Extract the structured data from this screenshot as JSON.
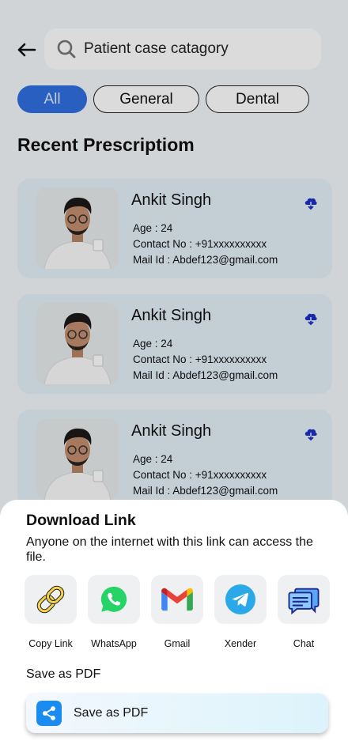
{
  "search": {
    "placeholder": "Patient case catagory"
  },
  "filters": [
    {
      "label": "All",
      "active": true
    },
    {
      "label": "General",
      "active": false
    },
    {
      "label": "Dental",
      "active": false
    }
  ],
  "section_title": "Recent Prescriptiom",
  "patients": [
    {
      "name": "Ankit Singh",
      "age": "Age : 24",
      "contact": "Contact No : +91xxxxxxxxxx",
      "mail": "Mail Id : Abdef123@gmail.com"
    },
    {
      "name": "Ankit Singh",
      "age": "Age : 24",
      "contact": "Contact No : +91xxxxxxxxxx",
      "mail": "Mail Id : Abdef123@gmail.com"
    },
    {
      "name": "Ankit Singh",
      "age": "Age : 24",
      "contact": "Contact No : +91xxxxxxxxxx",
      "mail": "Mail Id : Abdef123@gmail.com"
    }
  ],
  "sheet": {
    "title": "Download Link",
    "description": "Anyone on the internet with this link can access the file.",
    "share_options": [
      {
        "label": "Copy Link",
        "icon": "link-icon"
      },
      {
        "label": "WhatsApp",
        "icon": "whatsapp-icon"
      },
      {
        "label": "Gmail",
        "icon": "gmail-icon"
      },
      {
        "label": "Xender",
        "icon": "xender-icon"
      },
      {
        "label": "Chat",
        "icon": "chat-icon"
      }
    ],
    "pdf_section_label": "Save as PDF",
    "pdf_button_label": "Save as PDF"
  },
  "colors": {
    "accent": "#2f6fe0",
    "card_bg": "#e3f0f9",
    "download_icon": "#1a2fc7",
    "whatsapp": "#25d366",
    "share_blue": "#1a8cf0"
  }
}
